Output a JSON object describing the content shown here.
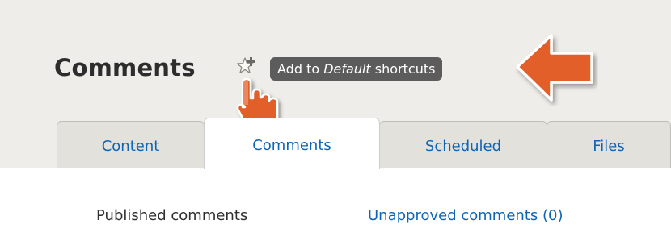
{
  "page": {
    "title": "Comments"
  },
  "shortcut": {
    "icon": "star-plus-icon",
    "tooltip_prefix": "Add to ",
    "tooltip_set": "Default",
    "tooltip_suffix": " shortcuts"
  },
  "tabs": [
    {
      "label": "Content",
      "active": false
    },
    {
      "label": "Comments",
      "active": true
    },
    {
      "label": "Scheduled",
      "active": false
    },
    {
      "label": "Files",
      "active": false
    }
  ],
  "secondary_tabs": [
    {
      "label": "Published comments",
      "active": true
    },
    {
      "label": "Unapproved comments (0)",
      "active": false
    }
  ],
  "colors": {
    "header_background": "#eeede9",
    "link": "#0e65b5",
    "tooltip_background": "#5c5c5c",
    "callout_arrow": "#e35f2c"
  }
}
